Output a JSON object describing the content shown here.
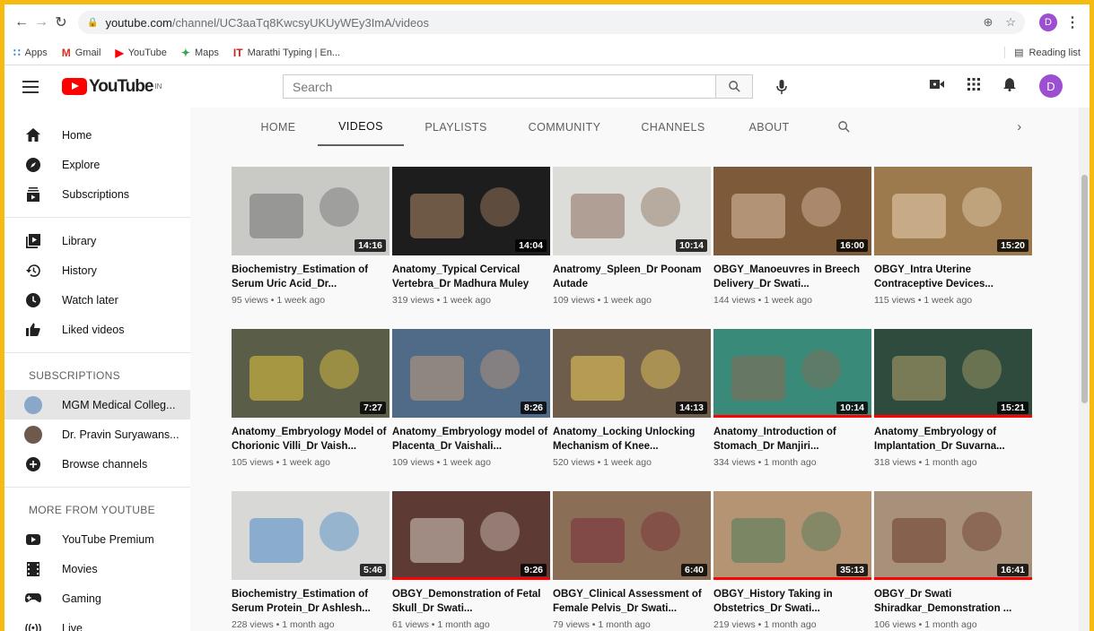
{
  "browser": {
    "url_host": "youtube.com",
    "url_path": "/channel/UC3aaTq8KwcsyUKUyWEy3ImA/videos",
    "profile_initial": "D",
    "bookmarks": [
      {
        "label": "Apps",
        "icon": "apps-grid-icon"
      },
      {
        "label": "Gmail",
        "icon": "gmail-icon"
      },
      {
        "label": "YouTube",
        "icon": "youtube-icon"
      },
      {
        "label": "Maps",
        "icon": "maps-icon"
      },
      {
        "label": "Marathi Typing | En...",
        "icon": "typing-icon"
      }
    ],
    "reading_list": "Reading list"
  },
  "header": {
    "logo_text": "YouTube",
    "country_code": "IN",
    "search_placeholder": "Search",
    "avatar_initial": "D"
  },
  "sidebar": {
    "main": [
      {
        "label": "Home",
        "icon": "home-icon"
      },
      {
        "label": "Explore",
        "icon": "explore-icon"
      },
      {
        "label": "Subscriptions",
        "icon": "subscriptions-icon"
      }
    ],
    "library": [
      {
        "label": "Library",
        "icon": "library-icon"
      },
      {
        "label": "History",
        "icon": "history-icon"
      },
      {
        "label": "Watch later",
        "icon": "watch-later-icon"
      },
      {
        "label": "Liked videos",
        "icon": "liked-icon"
      }
    ],
    "subscriptions_heading": "SUBSCRIPTIONS",
    "subscriptions": [
      {
        "label": "MGM Medical Colleg...",
        "color": "#8aa6c8"
      },
      {
        "label": "Dr. Pravin Suryawans...",
        "color": "#6d5a4c"
      }
    ],
    "browse_channels": "Browse channels",
    "more_heading": "MORE FROM YOUTUBE",
    "more": [
      {
        "label": "YouTube Premium",
        "icon": "youtube-premium-icon"
      },
      {
        "label": "Movies",
        "icon": "movies-icon"
      },
      {
        "label": "Gaming",
        "icon": "gaming-icon"
      },
      {
        "label": "Live",
        "icon": "live-icon"
      }
    ]
  },
  "tabs": [
    "HOME",
    "VIDEOS",
    "PLAYLISTS",
    "COMMUNITY",
    "CHANNELS",
    "ABOUT"
  ],
  "active_tab": "VIDEOS",
  "videos": [
    {
      "title": "Biochemistry_Estimation of Serum Uric Acid_Dr...",
      "meta": "95 views • 1 week ago",
      "duration": "14:16",
      "bg": "#c9c9c6",
      "accent": "#6d6d6d",
      "watched": false
    },
    {
      "title": "Anatomy_Typical Cervical Vertebra_Dr Madhura Muley",
      "meta": "319 views • 1 week ago",
      "duration": "14:04",
      "bg": "#1d1d1d",
      "accent": "#b08868",
      "watched": false
    },
    {
      "title": "Anatromy_Spleen_Dr Poonam Autade",
      "meta": "109 views • 1 week ago",
      "duration": "10:14",
      "bg": "#dcdcd8",
      "accent": "#8a6d5c",
      "watched": false
    },
    {
      "title": "OBGY_Manoeuvres in Breech Delivery_Dr Swati...",
      "meta": "144 views • 1 week ago",
      "duration": "16:00",
      "bg": "#7c5a3a",
      "accent": "#e0c2a8",
      "watched": false
    },
    {
      "title": "OBGY_Intra Uterine Contraceptive Devices...",
      "meta": "115 views • 1 week ago",
      "duration": "15:20",
      "bg": "#9d7a4e",
      "accent": "#e9d4b5",
      "watched": false
    },
    {
      "title": "Anatomy_Embryology Model of Chorionic Villi_Dr Vaish...",
      "meta": "105 views • 1 week ago",
      "duration": "7:27",
      "bg": "#5a5e48",
      "accent": "#e6c93e",
      "watched": false
    },
    {
      "title": "Anatomy_Embryology model of Placenta_Dr Vaishali...",
      "meta": "109 views • 1 week ago",
      "duration": "8:26",
      "bg": "#4f6b88",
      "accent": "#c59c7a",
      "watched": false
    },
    {
      "title": "Anatomy_Locking Unlocking Mechanism of Knee...",
      "meta": "520 views • 1 week ago",
      "duration": "14:13",
      "bg": "#6e5d4b",
      "accent": "#f0d05a",
      "watched": false
    },
    {
      "title": "Anatomy_Introduction of Stomach_Dr Manjiri...",
      "meta": "334 views • 1 month ago",
      "duration": "10:14",
      "bg": "#3a8a7a",
      "accent": "#8a6a52",
      "watched": true
    },
    {
      "title": "Anatomy_Embryology of Implantation_Dr Suvarna...",
      "meta": "318 views • 1 month ago",
      "duration": "15:21",
      "bg": "#2f4b3d",
      "accent": "#b4a46a",
      "watched": true
    },
    {
      "title": "Biochemistry_Estimation of Serum Protein_Dr Ashlesh...",
      "meta": "228 views • 1 month ago",
      "duration": "5:46",
      "bg": "#d8d8d6",
      "accent": "#4a8ac6",
      "watched": false
    },
    {
      "title": "OBGY_Demonstration of Fetal Skull_Dr Swati...",
      "meta": "61 views • 1 month ago",
      "duration": "9:26",
      "bg": "#5e3a34",
      "accent": "#d8cfc6",
      "watched": true
    },
    {
      "title": "OBGY_Clinical Assessment of Female Pelvis_Dr Swati...",
      "meta": "79 views • 1 month ago",
      "duration": "6:40",
      "bg": "#8a6e55",
      "accent": "#7a2e3a",
      "watched": false
    },
    {
      "title": "OBGY_History Taking in Obstetrics_Dr Swati...",
      "meta": "219 views • 1 month ago",
      "duration": "35:13",
      "bg": "#b49472",
      "accent": "#4a7a5a",
      "watched": true
    },
    {
      "title": "OBGY_Dr Swati Shiradkar_Demonstration ...",
      "meta": "106 views • 1 month ago",
      "duration": "16:41",
      "bg": "#a8917a",
      "accent": "#6a3a2a",
      "watched": true
    }
  ]
}
